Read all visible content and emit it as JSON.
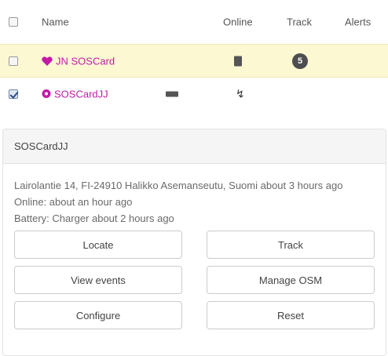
{
  "table": {
    "headers": {
      "name": "Name",
      "online": "Online",
      "track": "Track",
      "alerts": "Alerts"
    },
    "rows": [
      {
        "name": "JN SOSCard",
        "icon": "heart-icon",
        "name_color": "#c31aa6",
        "checked": false,
        "highlighted": true,
        "online_icon": "phone-icon",
        "track_badge": "5"
      },
      {
        "name": "SOSCardJJ",
        "icon": "gear-icon",
        "name_color": "#c31aa6",
        "checked": true,
        "highlighted": false,
        "status_icon": "battery-icon",
        "online_icon": "bolt-icon"
      }
    ]
  },
  "detail": {
    "title": "SOSCardJJ",
    "address_line": "Lairolantie 14, FI-24910 Halikko Asemanseutu, Suomi about 3 hours ago",
    "online_line": "Online: about an hour ago",
    "battery_line": "Battery: Charger about 2 hours ago",
    "buttons": {
      "locate": "Locate",
      "track": "Track",
      "view_events": "View events",
      "manage_osm": "Manage OSM",
      "configure": "Configure",
      "reset": "Reset"
    }
  },
  "colors": {
    "highlight_row": "#fcf8d2",
    "device_name": "#c31aa6",
    "badge": "#4e4e4e"
  }
}
